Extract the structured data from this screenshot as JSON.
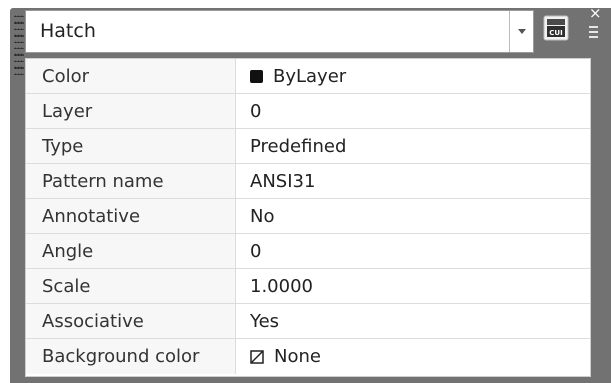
{
  "selector": {
    "value": "Hatch"
  },
  "cui_button": {
    "label": "CUI"
  },
  "close_glyph": "×",
  "properties": [
    {
      "label": "Color",
      "value": "ByLayer",
      "icon": "color-swatch-icon"
    },
    {
      "label": "Layer",
      "value": "0"
    },
    {
      "label": "Type",
      "value": "Predefined"
    },
    {
      "label": "Pattern name",
      "value": "ANSI31"
    },
    {
      "label": "Annotative",
      "value": "No"
    },
    {
      "label": "Angle",
      "value": "0"
    },
    {
      "label": "Scale",
      "value": "1.0000"
    },
    {
      "label": "Associative",
      "value": "Yes"
    },
    {
      "label": "Background color",
      "value": "None",
      "icon": "none-color-icon"
    }
  ],
  "colors": {
    "panel_bg": "#727272",
    "swatch": "#111111"
  }
}
